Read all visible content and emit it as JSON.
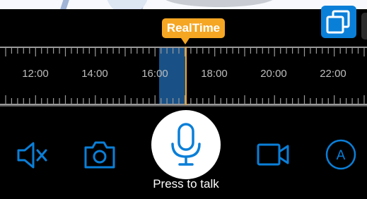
{
  "theme": {
    "accent": "#0a7fd8",
    "badge": "#f5a623",
    "background": "#000000",
    "segment": "#1d5f9e"
  },
  "header": {
    "multi_window_icon": "multi-window-icon"
  },
  "timeline": {
    "realtime_label": "RealTime",
    "tick_labels": [
      "12:00",
      "14:00",
      "16:00",
      "18:00",
      "20:00",
      "22:00"
    ]
  },
  "controls": {
    "mute_icon": "speaker-mute-icon",
    "snapshot_icon": "camera-icon",
    "talk_icon": "microphone-icon",
    "talk_label": "Press to talk",
    "record_icon": "video-camera-icon",
    "quality_icon": "auto-quality-icon",
    "quality_letter": "A"
  }
}
